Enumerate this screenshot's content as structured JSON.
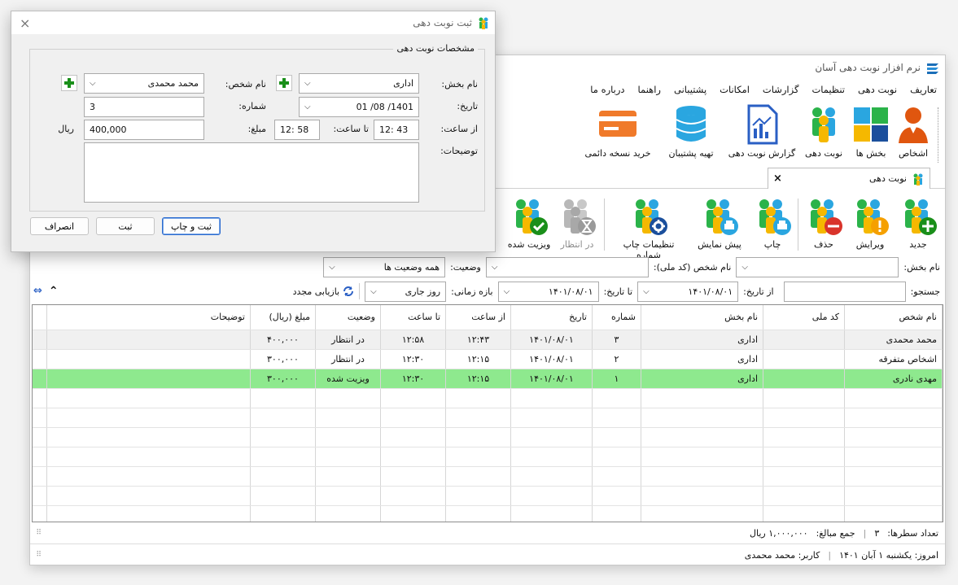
{
  "app": {
    "title": "نرم افزار نوبت دهی آسان",
    "menu": [
      "تعاریف",
      "نوبت دهی",
      "تنظیمات",
      "گزارشات",
      "امکانات",
      "پشتیبانی",
      "راهنما",
      "درباره ما"
    ]
  },
  "ribbon": {
    "persons": "اشخاص",
    "sections": "بخش ها",
    "appointment": "نوبت دهی",
    "report": "گزارش نوبت دهی",
    "backup": "تهیه پشتیبان",
    "buy": "خرید نسخه دائمی"
  },
  "tab": {
    "label": "نوبت دهی",
    "close": "×"
  },
  "toolbar": {
    "new": "جدید",
    "edit": "ویرایش",
    "delete": "حذف",
    "print": "چاپ",
    "preview": "پیش نمایش",
    "print_settings": "تنظیمات چاپ شماره",
    "waiting": "در انتظار",
    "visited": "ویزیت شده"
  },
  "filters": {
    "section_label": "نام بخش:",
    "section_value": "",
    "person_label": "نام شخص (کد ملی):",
    "person_value": "",
    "status_label": "وضعیت:",
    "status_value": "همه وضعیت ها",
    "search_label": "جستجو:",
    "search_value": "",
    "from_date_label": "از تاریخ:",
    "from_date_value": "۱۴۰۱/۰۸/۰۱",
    "to_date_label": "تا تاریخ:",
    "to_date_value": "۱۴۰۱/۰۸/۰۱",
    "range_label": "بازه زمانی:",
    "range_value": "روز جاری",
    "reload": "بازیابی مجدد"
  },
  "grid": {
    "columns": [
      "نام شخص",
      "کد ملی",
      "نام بخش",
      "شماره",
      "تاریخ",
      "از ساعت",
      "تا ساعت",
      "وضعیت",
      "مبلغ (ریال)",
      "توضیحات"
    ],
    "rows": [
      {
        "name": "محمد محمدی",
        "national_id": "",
        "section": "اداری",
        "number": "۳",
        "date": "۱۴۰۱/۰۸/۰۱",
        "from": "۱۲:۴۳",
        "to": "۱۲:۵۸",
        "status": "در انتظار",
        "amount": "۴۰۰,۰۰۰",
        "desc": ""
      },
      {
        "name": "اشخاص متفرقه",
        "national_id": "",
        "section": "اداری",
        "number": "۲",
        "date": "۱۴۰۱/۰۸/۰۱",
        "from": "۱۲:۱۵",
        "to": "۱۲:۳۰",
        "status": "در انتظار",
        "amount": "۳۰۰,۰۰۰",
        "desc": ""
      },
      {
        "name": "مهدی نادری",
        "national_id": "",
        "section": "اداری",
        "number": "۱",
        "date": "۱۴۰۱/۰۸/۰۱",
        "from": "۱۲:۱۵",
        "to": "۱۲:۳۰",
        "status": "ویزیت شده",
        "amount": "۳۰۰,۰۰۰",
        "desc": ""
      }
    ]
  },
  "summary": {
    "row_count_label": "تعداد سطرها:",
    "row_count": "۳",
    "sum_label": "جمع مبالغ:",
    "sum_value": "۱,۰۰۰,۰۰۰ ریال"
  },
  "status": {
    "today": "امروز: یکشنبه ۱ آبان ۱۴۰۱",
    "user": "کاربر: محمد محمدی"
  },
  "dialog": {
    "title": "ثبت نوبت دهی",
    "close": "×",
    "group_title": "مشخصات نوبت دهی",
    "section_label": "نام بخش:",
    "section_value": "اداری",
    "person_label": "نام شخص:",
    "person_value": "محمد محمدی",
    "date_label": "تاریخ:",
    "date_value": "1401/ 08/ 01",
    "number_label": "شماره:",
    "number_value": "3",
    "from_label": "از ساعت:",
    "from_value": "12: 43",
    "to_label": "تا ساعت:",
    "to_value": "12: 58",
    "amount_label": "مبلغ:",
    "amount_value": "400,000",
    "currency": "ریال",
    "desc_label": "توضیحات:",
    "desc_value": "",
    "btn_save_print": "ثبت و چاپ",
    "btn_save": "ثبت",
    "btn_cancel": "انصراف"
  },
  "colors": {
    "visited_row": "#8ee98e",
    "accent": "#2b6bcf",
    "add_green": "#1a8f1a"
  }
}
